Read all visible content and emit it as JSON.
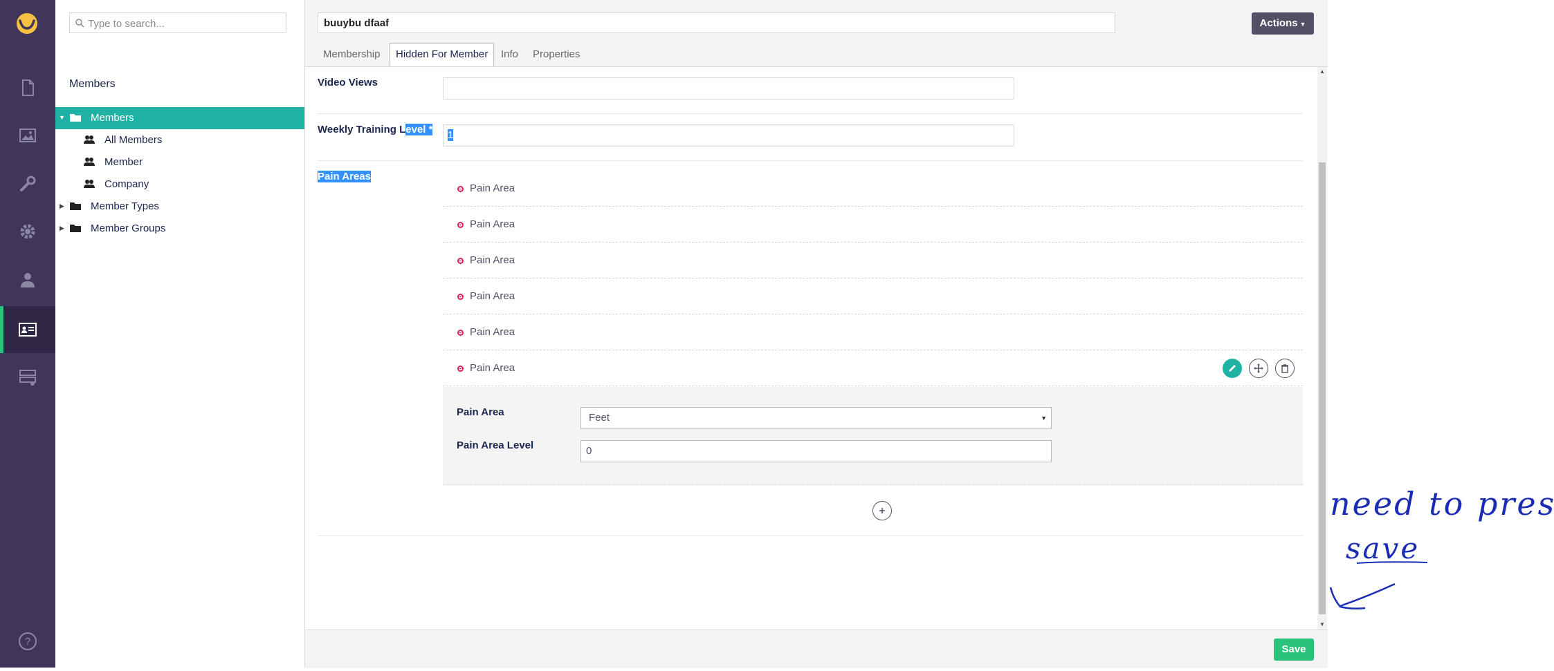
{
  "search": {
    "placeholder": "Type to search..."
  },
  "tree": {
    "title": "Members",
    "nodes": [
      {
        "label": "Members"
      },
      {
        "label": "All Members"
      },
      {
        "label": "Member"
      },
      {
        "label": "Company"
      },
      {
        "label": "Member Types"
      },
      {
        "label": "Member Groups"
      }
    ]
  },
  "header": {
    "name_value": "buuybu dfaaf",
    "actions_label": "Actions",
    "tabs": [
      {
        "label": "Membership"
      },
      {
        "label": "Hidden For Member"
      },
      {
        "label": "Info"
      },
      {
        "label": "Properties"
      }
    ]
  },
  "form": {
    "video_views_label": "Video Views",
    "video_views_value": "",
    "weekly_label_plain": "Weekly Training L",
    "weekly_label_highlight": "evel *",
    "weekly_value": "1",
    "pain_areas_label": "Pain Areas",
    "pain_area_items": [
      "Pain Area",
      "Pain Area",
      "Pain Area",
      "Pain Area",
      "Pain Area",
      "Pain Area"
    ],
    "sub_pain_area_label": "Pain Area",
    "sub_pain_area_value": "Feet",
    "sub_pain_level_label": "Pain Area Level",
    "sub_pain_level_value": "0"
  },
  "footer": {
    "save_label": "Save"
  },
  "annotation": {
    "line1": "need to press",
    "line2": "save"
  },
  "colors": {
    "rail": "#413659",
    "accent_teal": "#1fb2a4",
    "save_green": "#2bc37c",
    "highlight": "#3390ff"
  }
}
